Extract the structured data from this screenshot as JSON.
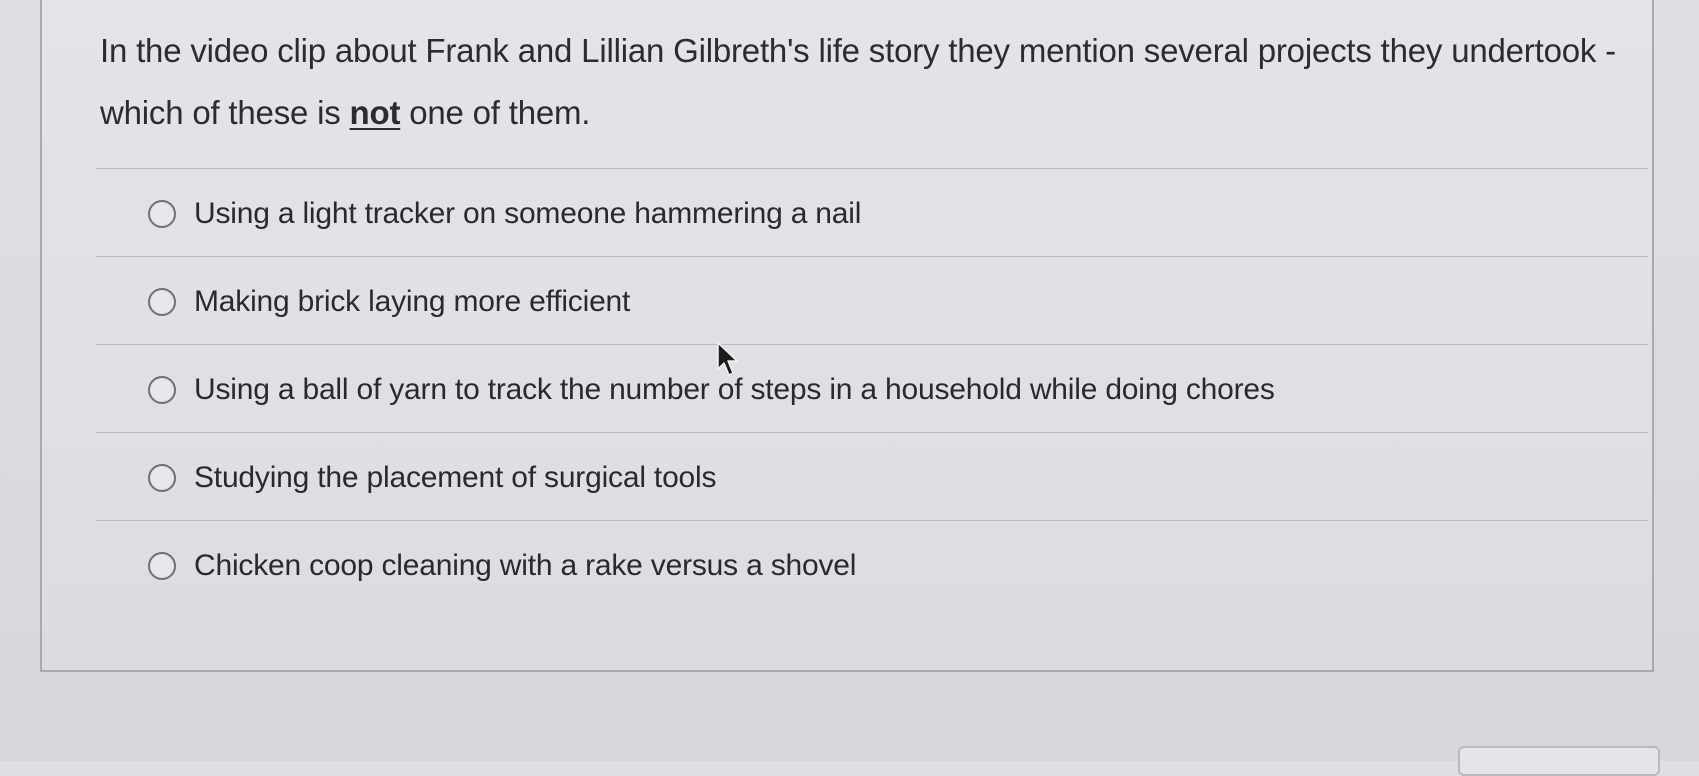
{
  "question": {
    "text_before": "In the video clip about Frank and Lillian Gilbreth's life story they mention several projects they undertook - which of these is ",
    "emphasis": "not",
    "text_after": " one of them."
  },
  "options": [
    "Using a light tracker on someone hammering a nail",
    "Making brick laying more efficient",
    "Using a ball of yarn to track the number of steps in a household while doing chores",
    "Studying the placement of surgical tools",
    "Chicken coop cleaning with a rake versus a shovel"
  ],
  "icons": {
    "radio": "radio-button-icon",
    "cursor": "mouse-pointer-icon"
  },
  "colors": {
    "background": "#dcdde1",
    "card_border": "#a9aaae",
    "text": "#2b2b30",
    "radio_border": "#6f7075"
  }
}
